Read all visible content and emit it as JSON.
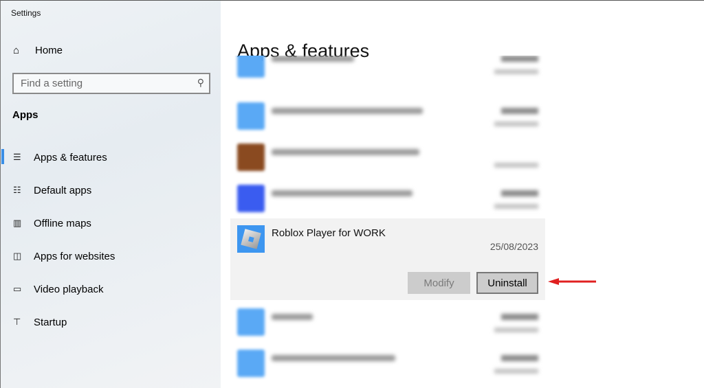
{
  "window_title": "Settings",
  "sidebar": {
    "home_label": "Home",
    "search_placeholder": "Find a setting",
    "section": "Apps",
    "items": [
      {
        "label": "Apps & features",
        "icon": "list-icon",
        "active": true
      },
      {
        "label": "Default apps",
        "icon": "default-apps-icon"
      },
      {
        "label": "Offline maps",
        "icon": "map-icon"
      },
      {
        "label": "Apps for websites",
        "icon": "link-window-icon"
      },
      {
        "label": "Video playback",
        "icon": "video-icon"
      },
      {
        "label": "Startup",
        "icon": "startup-icon"
      }
    ]
  },
  "main": {
    "title": "Apps & features",
    "selected_app": {
      "name": "Roblox Player for WORK",
      "date": "25/08/2023",
      "modify_label": "Modify",
      "uninstall_label": "Uninstall"
    },
    "annotation_color": "#e02020",
    "accent": "#3a8ee6"
  }
}
